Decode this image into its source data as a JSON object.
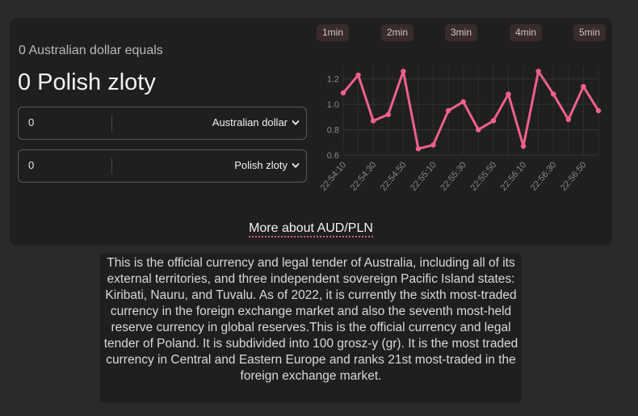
{
  "converter": {
    "equals_label": "0 Australian dollar equals",
    "result": "0 Polish zloty",
    "from": {
      "value": "0",
      "currency": "Australian dollar"
    },
    "to": {
      "value": "0",
      "currency": "Polish zloty"
    }
  },
  "timeframes": [
    "1min",
    "2min",
    "3min",
    "4min",
    "5min"
  ],
  "more_link": "More about AUD/PLN",
  "description": "This is the official currency and legal tender of Australia, including all of its external territories, and three independent sovereign Pacific Island states: Kiribati, Nauru, and Tuvalu. As of 2022, it is currently the sixth most-traded currency in the foreign exchange market and also the seventh most-held reserve currency in global reserves.This is the official currency and legal tender of Poland. It is subdivided into 100 grosz-y (gr). It is the most traded currency in Central and Eastern Europe and ranks 21st most-traded in the foreign exchange market.",
  "chart_data": {
    "type": "line",
    "x": [
      "22:54:10",
      "22:54:20",
      "22:54:30",
      "22:54:40",
      "22:54:50",
      "22:55:00",
      "22:55:10",
      "22:55:20",
      "22:55:30",
      "22:55:40",
      "22:55:50",
      "22:56:00",
      "22:56:10",
      "22:56:20",
      "22:56:30",
      "22:56:40",
      "22:56:50",
      "22:57:00"
    ],
    "x_tick_labels": [
      "22:54:10",
      "22:54:30",
      "22:54:50",
      "22:55:10",
      "22:55:30",
      "22:55:50",
      "22:56:10",
      "22:56:30",
      "22:56:50"
    ],
    "values": [
      1.09,
      1.23,
      0.87,
      0.92,
      1.26,
      0.65,
      0.68,
      0.95,
      1.02,
      0.8,
      0.87,
      1.08,
      0.67,
      1.26,
      1.08,
      0.88,
      1.14,
      0.95
    ],
    "ylim": [
      0.6,
      1.3
    ],
    "y_ticks": [
      0.6,
      0.8,
      1.0,
      1.2
    ],
    "y_tick_labels": [
      "0.6",
      "0.8",
      "1.0",
      "1.2"
    ],
    "line_color": "#f0608a",
    "grid": true
  }
}
